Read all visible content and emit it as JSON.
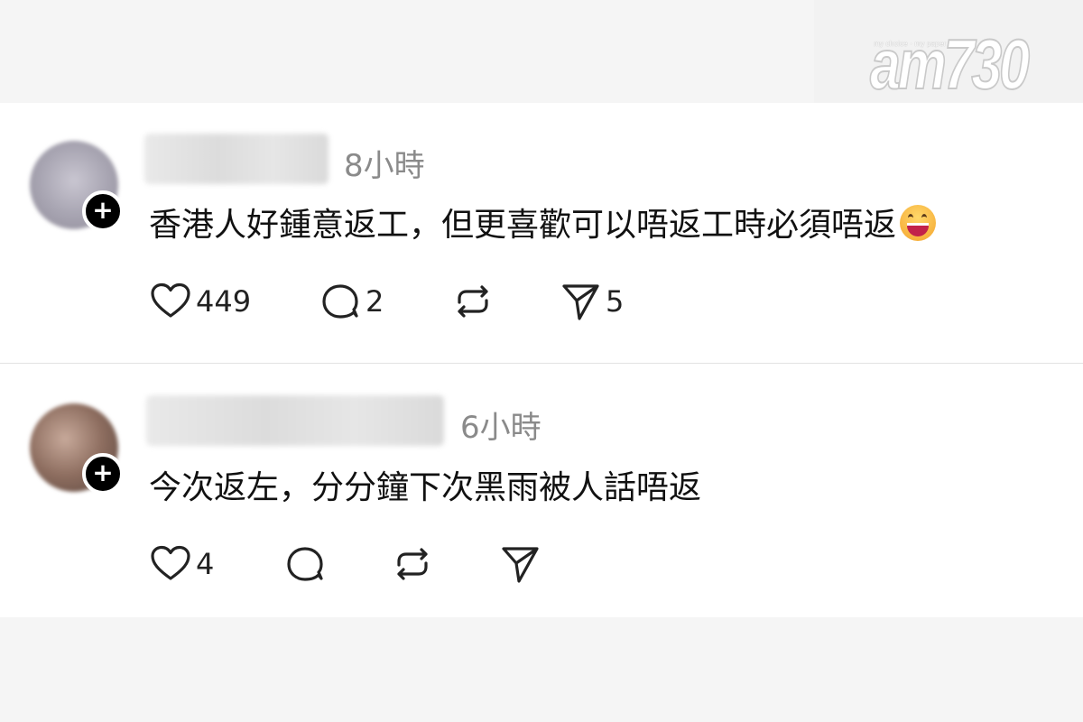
{
  "logo": {
    "tagline": "my choice · my paper",
    "text": "am730"
  },
  "posts": [
    {
      "time": "8小時",
      "text": "香港人好鍾意返工，但更喜歡可以唔返工時必須唔返",
      "emoji": "grinning-face-emoji",
      "likes": "449",
      "replies": "2",
      "reposts": "",
      "shares": "5"
    },
    {
      "time": "6小時",
      "text": "今次返左，分分鐘下次黑雨被人話唔返",
      "likes": "4",
      "replies": "",
      "reposts": "",
      "shares": ""
    }
  ],
  "colors": {
    "background": "#f5f5f5",
    "card": "#ffffff",
    "time": "#8a8a8a",
    "text": "#111111",
    "badge": "#000000"
  }
}
